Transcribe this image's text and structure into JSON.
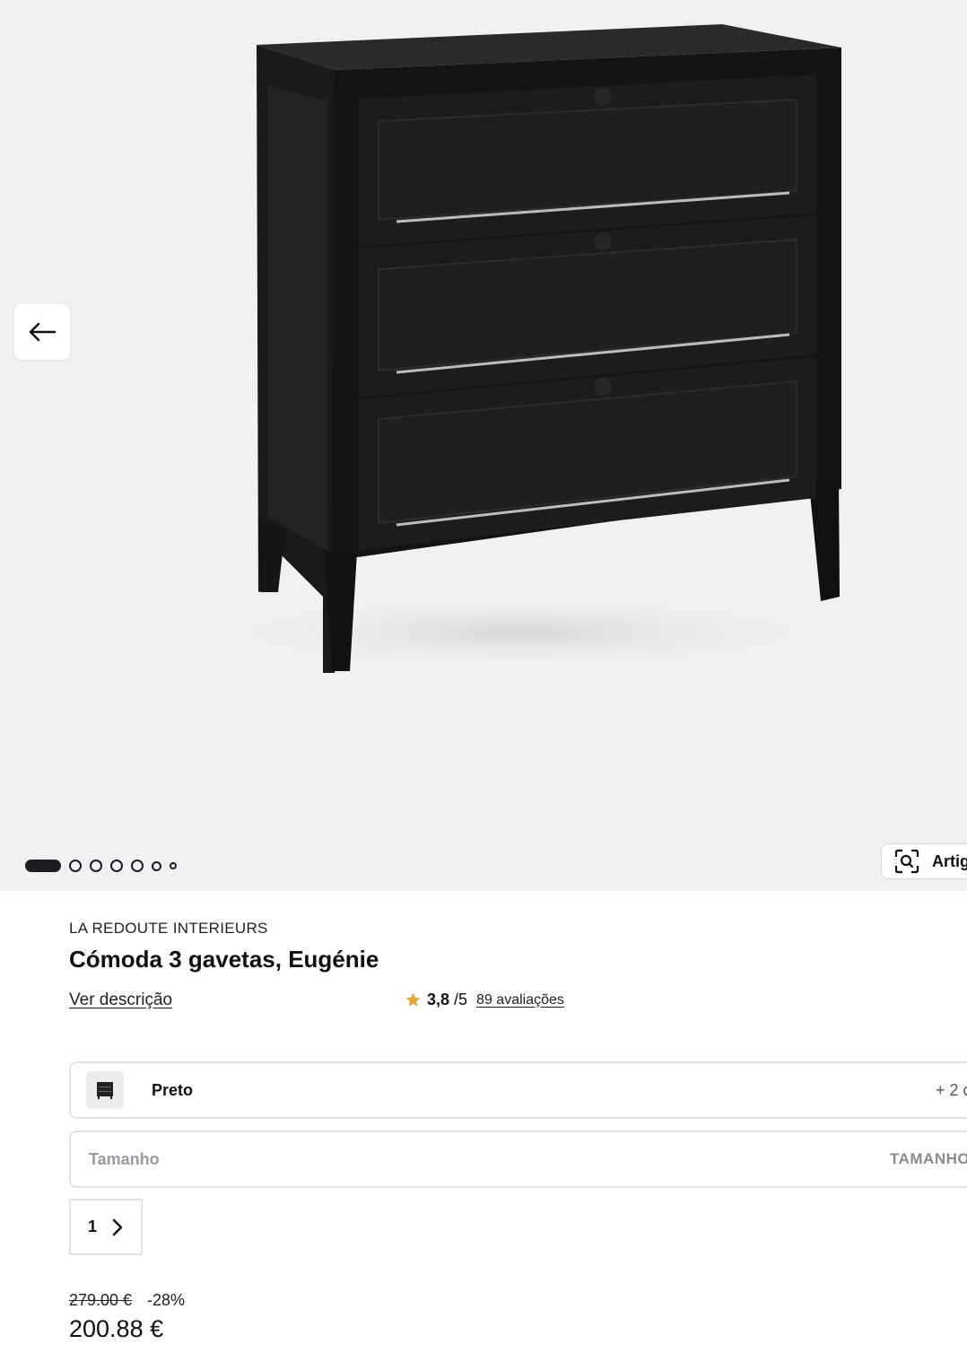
{
  "gallery": {
    "image_alt": "Cómoda 3 gavetas, Eugénie",
    "slide_count": 7,
    "current_slide": 1,
    "similar_button_label": "Artig"
  },
  "product": {
    "brand": "LA REDOUTE INTERIEURS",
    "title": "Cómoda 3 gavetas, Eugénie",
    "description_link": "Ver descrição",
    "rating": {
      "score": "3,8",
      "max": "/5",
      "reviews_link": "89 avaliações"
    }
  },
  "options": {
    "color": {
      "selected": "Preto",
      "more": "+ 2 c"
    },
    "size": {
      "placeholder": "Tamanho",
      "guide_label": "TAMANHO"
    },
    "quantity": "1"
  },
  "pricing": {
    "old_price": "279.00 €",
    "discount": "-28%",
    "price": "200.88 €"
  },
  "colors": {
    "background": "#f1f1f3",
    "accent": "#1b1b22",
    "star": "#e6a23c"
  }
}
